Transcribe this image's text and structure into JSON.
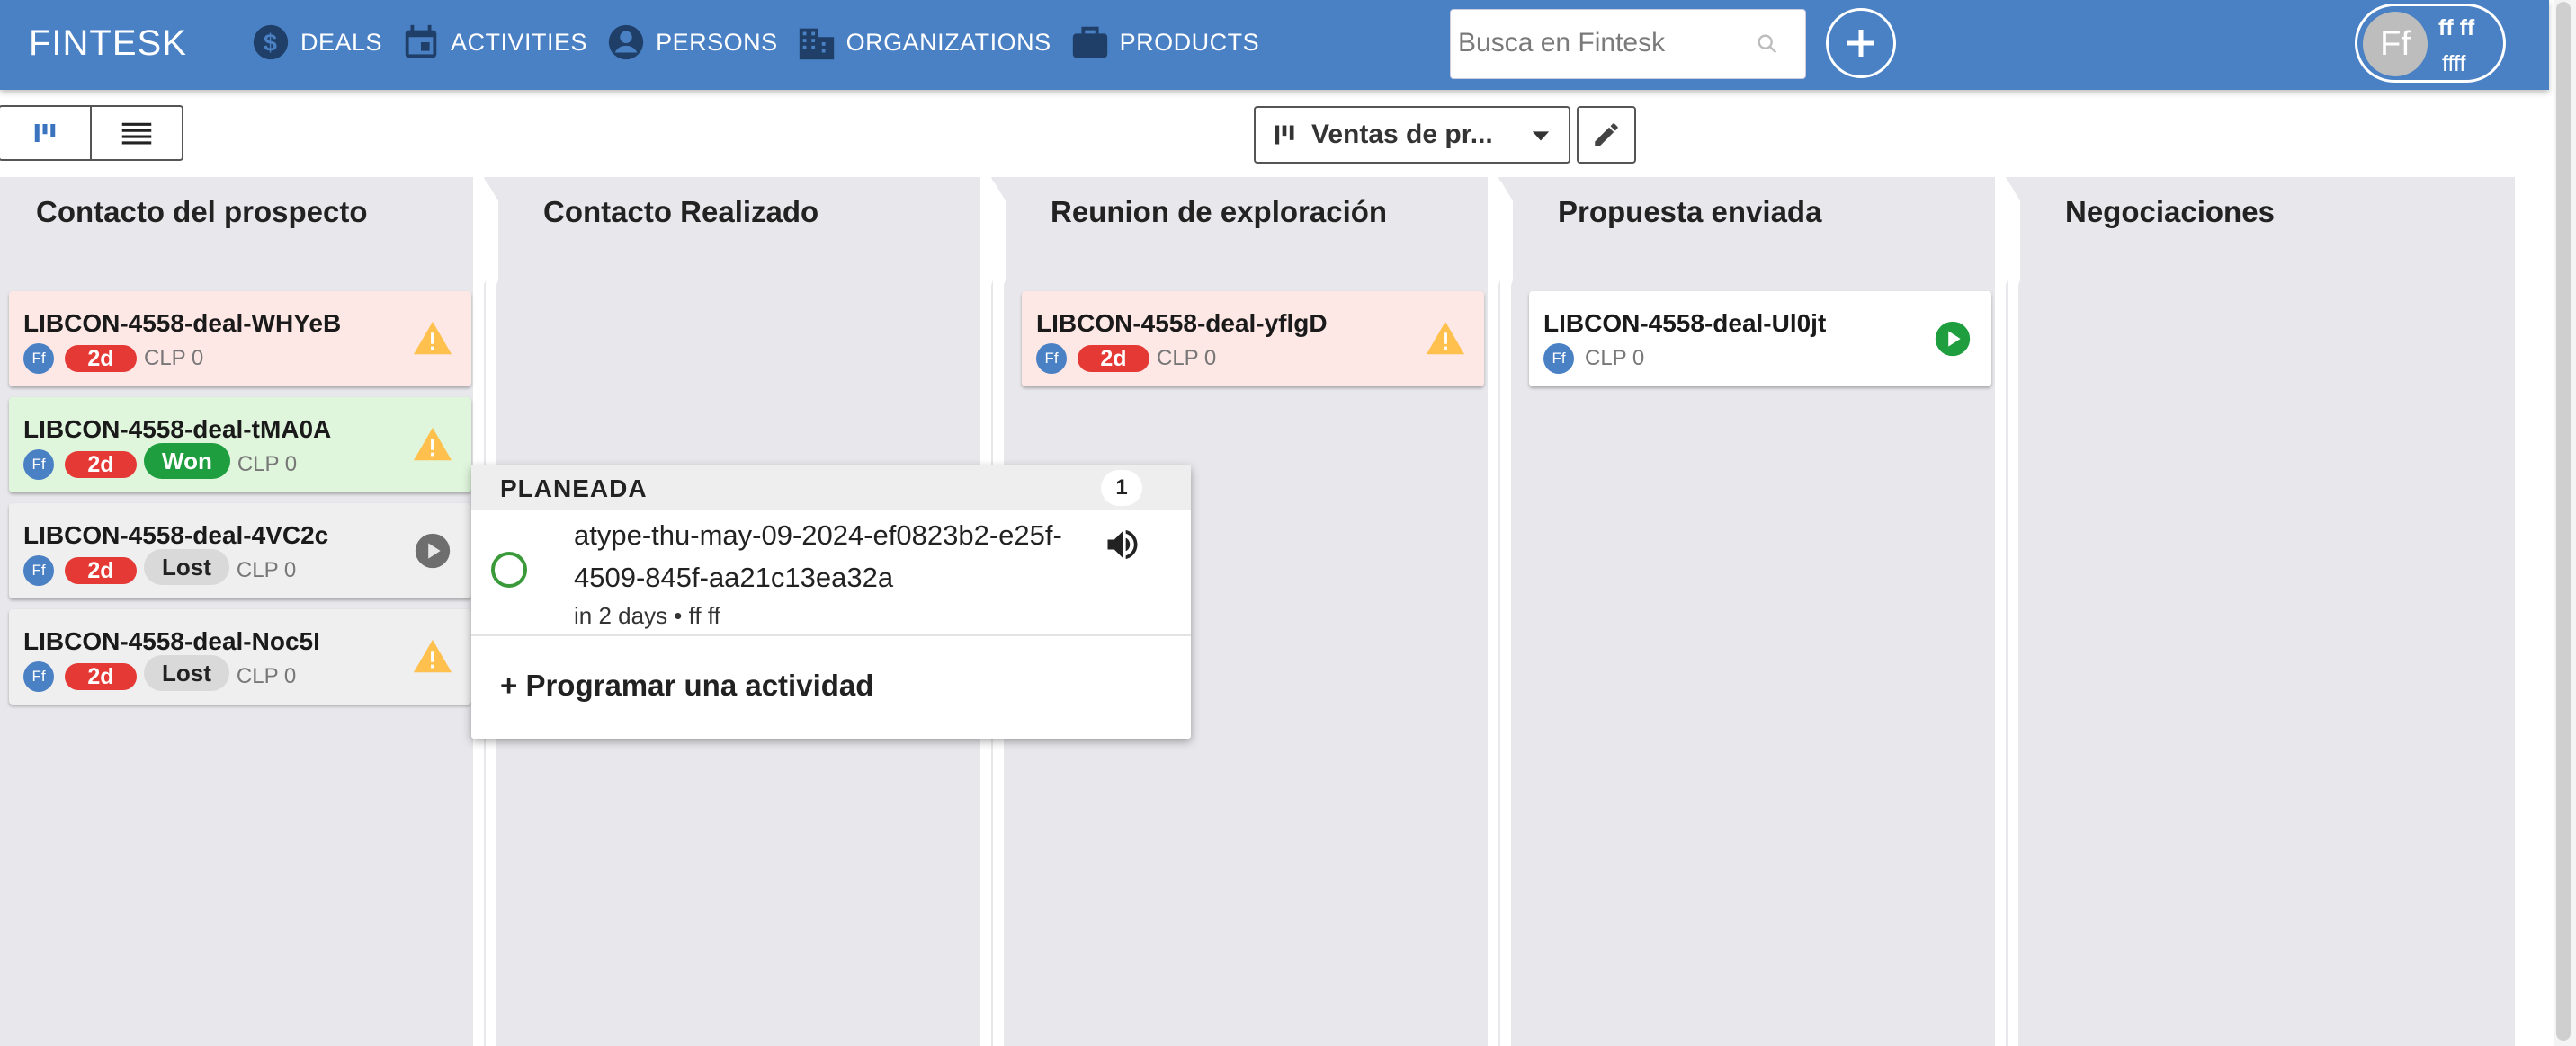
{
  "app": {
    "brand": "FINTESK",
    "nav": [
      {
        "label": "DEALS",
        "icon": "dollar-circle-icon"
      },
      {
        "label": "ACTIVITIES",
        "icon": "calendar-icon"
      },
      {
        "label": "PERSONS",
        "icon": "person-circle-icon"
      },
      {
        "label": "ORGANIZATIONS",
        "icon": "building-icon"
      },
      {
        "label": "PRODUCTS",
        "icon": "briefcase-icon"
      }
    ],
    "search_placeholder": "Busca en Fintesk",
    "user": {
      "initials": "Ff",
      "name": "ff ff",
      "sub": "ffff"
    }
  },
  "toolbar": {
    "pipeline_label": "Ventas de pr..."
  },
  "colors": {
    "topbar": "#4a80c4",
    "danger": "#e53935",
    "won": "#1e9e3e",
    "board": "#e8e8ec"
  },
  "stages": [
    {
      "title": "Contacto del prospecto",
      "deals": [
        {
          "title": "LIBCON-4558-deal-WHYeB",
          "owner": "Ff",
          "age": "2d",
          "status": "",
          "amount": "CLP 0",
          "icon": "warning-icon"
        },
        {
          "title": "LIBCON-4558-deal-tMA0A",
          "owner": "Ff",
          "age": "2d",
          "status": "Won",
          "amount": "CLP 0",
          "icon": "warning-icon"
        },
        {
          "title": "LIBCON-4558-deal-4VC2c",
          "owner": "Ff",
          "age": "2d",
          "status": "Lost",
          "amount": "CLP 0",
          "icon": "play-grey-icon"
        },
        {
          "title": "LIBCON-4558-deal-Noc5I",
          "owner": "Ff",
          "age": "2d",
          "status": "Lost",
          "amount": "CLP 0",
          "icon": "warning-icon"
        }
      ]
    },
    {
      "title": "Contacto Realizado",
      "deals": []
    },
    {
      "title": "Reunion de exploración",
      "deals": [
        {
          "title": "LIBCON-4558-deal-yflgD",
          "owner": "Ff",
          "age": "2d",
          "status": "",
          "amount": "CLP 0",
          "icon": "warning-icon"
        }
      ]
    },
    {
      "title": "Propuesta enviada",
      "deals": [
        {
          "title": "LIBCON-4558-deal-Ul0jt",
          "owner": "Ff",
          "age": "",
          "status": "",
          "amount": "CLP 0",
          "icon": "play-green-icon"
        }
      ]
    },
    {
      "title": "Negociaciones",
      "deals": []
    }
  ],
  "popup": {
    "section": "PLANEADA",
    "count": "1",
    "activity": {
      "name": "atype-thu-may-09-2024-ef0823b2-e25f-4509-845f-aa21c13ea32a",
      "meta": "in 2 days • ff ff"
    },
    "schedule_label": "+ Programar una actividad"
  }
}
